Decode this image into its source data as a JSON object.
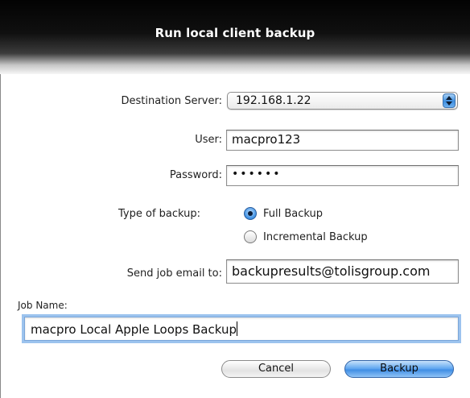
{
  "window": {
    "title": "Run local client backup"
  },
  "destination": {
    "label": "Destination Server:",
    "value": "192.168.1.22"
  },
  "user": {
    "label": "User:",
    "value": "macpro123"
  },
  "password": {
    "label": "Password:",
    "value": "••••••"
  },
  "backup_type": {
    "label": "Type of backup:",
    "options": [
      {
        "label": "Full Backup",
        "selected": true
      },
      {
        "label": "Incremental Backup",
        "selected": false
      }
    ]
  },
  "email": {
    "label": "Send job email to:",
    "value": "backupresults@tolisgroup.com"
  },
  "job": {
    "label": "Job Name:",
    "value": "macpro Local Apple Loops Backup"
  },
  "buttons": {
    "cancel": "Cancel",
    "backup": "Backup"
  },
  "colors": {
    "accent": "#3f8de4",
    "titlebar": "#0a0a0a"
  }
}
